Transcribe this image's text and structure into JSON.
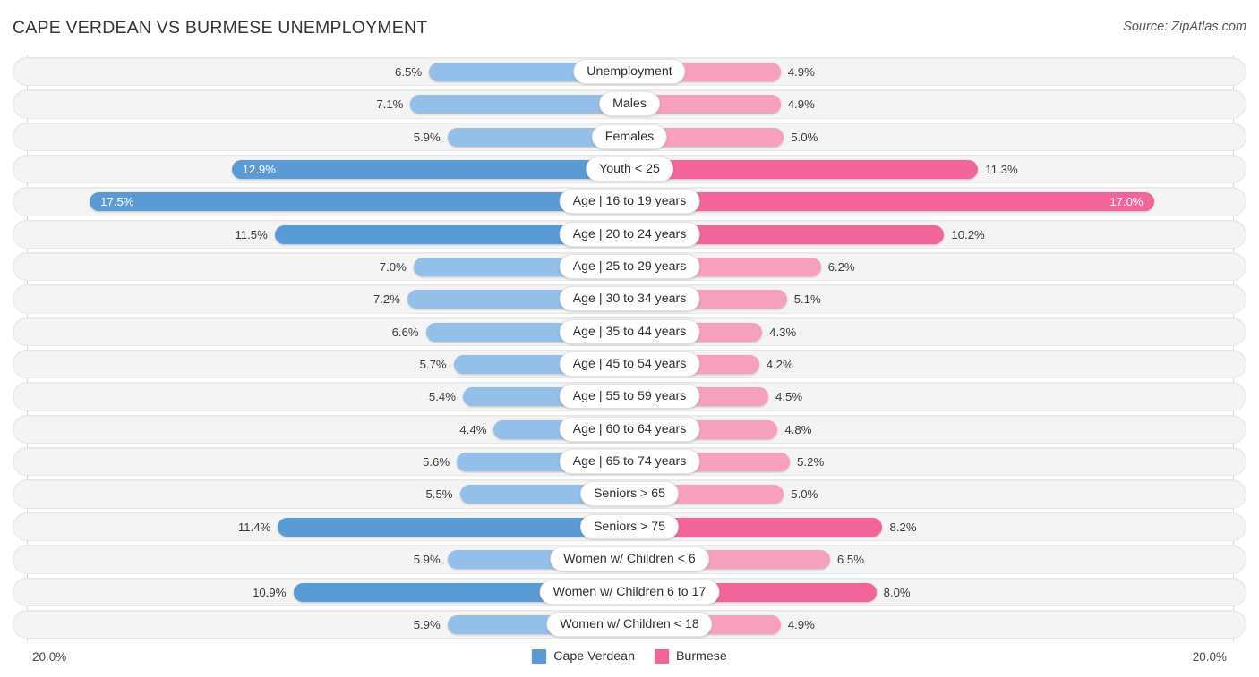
{
  "header": {
    "title": "CAPE VERDEAN VS BURMESE UNEMPLOYMENT",
    "source": "Source: ZipAtlas.com"
  },
  "legend": {
    "items": [
      {
        "label": "Cape Verdean",
        "color": "#5B9BD5"
      },
      {
        "label": "Burmese",
        "color": "#F2659B"
      }
    ]
  },
  "axis": {
    "left_max_label": "20.0%",
    "right_max_label": "20.0%",
    "max": 20.0
  },
  "colors": {
    "left_normal": "#94BFE8",
    "left_highlight": "#5B9BD5",
    "right_normal": "#F6A0BE",
    "right_highlight": "#F2659B",
    "track": "#f4f4f4",
    "pill_bg": "#ffffff"
  },
  "chart_data": {
    "type": "bar",
    "orientation": "horizontal-diverging",
    "title": "CAPE VERDEAN VS BURMESE UNEMPLOYMENT",
    "xlabel": "",
    "ylabel": "",
    "xlim": [
      0,
      20
    ],
    "grid": false,
    "legend_position": "bottom-center",
    "units": "%",
    "categories": [
      "Unemployment",
      "Males",
      "Females",
      "Youth < 25",
      "Age | 16 to 19 years",
      "Age | 20 to 24 years",
      "Age | 25 to 29 years",
      "Age | 30 to 34 years",
      "Age | 35 to 44 years",
      "Age | 45 to 54 years",
      "Age | 55 to 59 years",
      "Age | 60 to 64 years",
      "Age | 65 to 74 years",
      "Seniors > 65",
      "Seniors > 75",
      "Women w/ Children < 6",
      "Women w/ Children 6 to 17",
      "Women w/ Children < 18"
    ],
    "series": [
      {
        "name": "Cape Verdean",
        "side": "left",
        "values": [
          6.5,
          7.1,
          5.9,
          12.9,
          17.5,
          11.5,
          7.0,
          7.2,
          6.6,
          5.7,
          5.4,
          4.4,
          5.6,
          5.5,
          11.4,
          5.9,
          10.9,
          5.9
        ],
        "labels": [
          "6.5%",
          "7.1%",
          "5.9%",
          "12.9%",
          "17.5%",
          "11.5%",
          "7.0%",
          "7.2%",
          "6.6%",
          "5.7%",
          "5.4%",
          "4.4%",
          "5.6%",
          "5.5%",
          "11.4%",
          "5.9%",
          "10.9%",
          "5.9%"
        ]
      },
      {
        "name": "Burmese",
        "side": "right",
        "values": [
          4.9,
          4.9,
          5.0,
          11.3,
          17.0,
          10.2,
          6.2,
          5.1,
          4.3,
          4.2,
          4.5,
          4.8,
          5.2,
          5.0,
          8.2,
          6.5,
          8.0,
          4.9
        ],
        "labels": [
          "4.9%",
          "4.9%",
          "5.0%",
          "11.3%",
          "17.0%",
          "10.2%",
          "6.2%",
          "5.1%",
          "4.3%",
          "4.2%",
          "4.5%",
          "4.8%",
          "5.2%",
          "5.0%",
          "8.2%",
          "6.5%",
          "8.0%",
          "4.9%"
        ]
      }
    ]
  },
  "rows": [
    {
      "label": "Unemployment",
      "left": "6.5%",
      "right": "4.9%",
      "left_val": 6.5,
      "right_val": 4.9,
      "highlight": false,
      "left_inside": false,
      "right_inside": false
    },
    {
      "label": "Males",
      "left": "7.1%",
      "right": "4.9%",
      "left_val": 7.1,
      "right_val": 4.9,
      "highlight": false,
      "left_inside": false,
      "right_inside": false
    },
    {
      "label": "Females",
      "left": "5.9%",
      "right": "5.0%",
      "left_val": 5.9,
      "right_val": 5.0,
      "highlight": false,
      "left_inside": false,
      "right_inside": false
    },
    {
      "label": "Youth < 25",
      "left": "12.9%",
      "right": "11.3%",
      "left_val": 12.9,
      "right_val": 11.3,
      "highlight": true,
      "left_inside": true,
      "right_inside": false
    },
    {
      "label": "Age | 16 to 19 years",
      "left": "17.5%",
      "right": "17.0%",
      "left_val": 17.5,
      "right_val": 17.0,
      "highlight": true,
      "left_inside": true,
      "right_inside": true
    },
    {
      "label": "Age | 20 to 24 years",
      "left": "11.5%",
      "right": "10.2%",
      "left_val": 11.5,
      "right_val": 10.2,
      "highlight": true,
      "left_inside": false,
      "right_inside": false
    },
    {
      "label": "Age | 25 to 29 years",
      "left": "7.0%",
      "right": "6.2%",
      "left_val": 7.0,
      "right_val": 6.2,
      "highlight": false,
      "left_inside": false,
      "right_inside": false
    },
    {
      "label": "Age | 30 to 34 years",
      "left": "7.2%",
      "right": "5.1%",
      "left_val": 7.2,
      "right_val": 5.1,
      "highlight": false,
      "left_inside": false,
      "right_inside": false
    },
    {
      "label": "Age | 35 to 44 years",
      "left": "6.6%",
      "right": "4.3%",
      "left_val": 6.6,
      "right_val": 4.3,
      "highlight": false,
      "left_inside": false,
      "right_inside": false
    },
    {
      "label": "Age | 45 to 54 years",
      "left": "5.7%",
      "right": "4.2%",
      "left_val": 5.7,
      "right_val": 4.2,
      "highlight": false,
      "left_inside": false,
      "right_inside": false
    },
    {
      "label": "Age | 55 to 59 years",
      "left": "5.4%",
      "right": "4.5%",
      "left_val": 5.4,
      "right_val": 4.5,
      "highlight": false,
      "left_inside": false,
      "right_inside": false
    },
    {
      "label": "Age | 60 to 64 years",
      "left": "4.4%",
      "right": "4.8%",
      "left_val": 4.4,
      "right_val": 4.8,
      "highlight": false,
      "left_inside": false,
      "right_inside": false
    },
    {
      "label": "Age | 65 to 74 years",
      "left": "5.6%",
      "right": "5.2%",
      "left_val": 5.6,
      "right_val": 5.2,
      "highlight": false,
      "left_inside": false,
      "right_inside": false
    },
    {
      "label": "Seniors > 65",
      "left": "5.5%",
      "right": "5.0%",
      "left_val": 5.5,
      "right_val": 5.0,
      "highlight": false,
      "left_inside": false,
      "right_inside": false
    },
    {
      "label": "Seniors > 75",
      "left": "11.4%",
      "right": "8.2%",
      "left_val": 11.4,
      "right_val": 8.2,
      "highlight": true,
      "left_inside": false,
      "right_inside": false
    },
    {
      "label": "Women w/ Children < 6",
      "left": "5.9%",
      "right": "6.5%",
      "left_val": 5.9,
      "right_val": 6.5,
      "highlight": false,
      "left_inside": false,
      "right_inside": false
    },
    {
      "label": "Women w/ Children 6 to 17",
      "left": "10.9%",
      "right": "8.0%",
      "left_val": 10.9,
      "right_val": 8.0,
      "highlight": true,
      "left_inside": false,
      "right_inside": false
    },
    {
      "label": "Women w/ Children < 18",
      "left": "5.9%",
      "right": "4.9%",
      "left_val": 5.9,
      "right_val": 4.9,
      "highlight": false,
      "left_inside": false,
      "right_inside": false
    }
  ]
}
